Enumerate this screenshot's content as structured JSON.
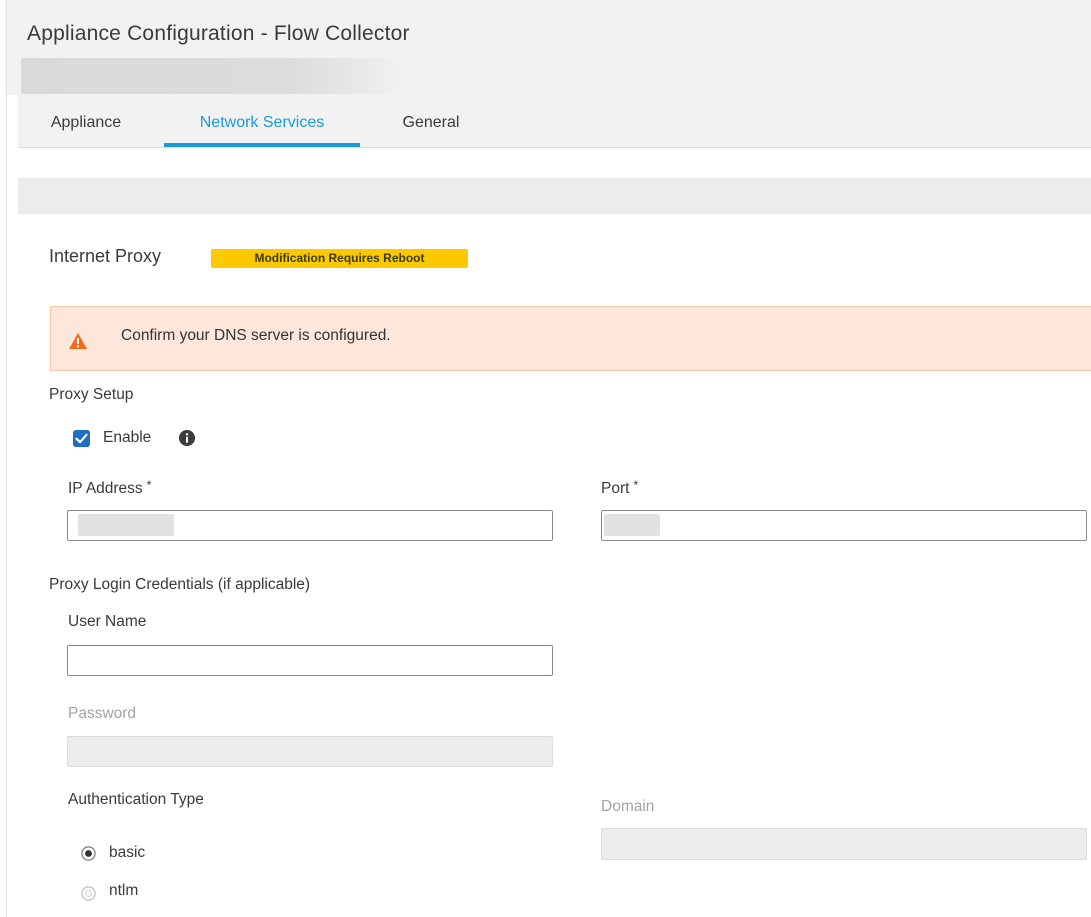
{
  "header": {
    "title": "Appliance Configuration - Flow Collector"
  },
  "tabs": [
    {
      "label": "Appliance",
      "active": false
    },
    {
      "label": "Network Services",
      "active": true
    },
    {
      "label": "General",
      "active": false
    }
  ],
  "section": {
    "title": "Internet Proxy",
    "badge": "Modification Requires Reboot"
  },
  "alert": {
    "text": "Confirm your DNS server is configured.",
    "icon": "warning-triangle-icon"
  },
  "proxy_setup": {
    "label": "Proxy Setup",
    "enable_label": "Enable",
    "enable_checked": true,
    "ip_label": "IP Address",
    "port_label": "Port",
    "required_mark": "*"
  },
  "credentials": {
    "label": "Proxy Login Credentials (if applicable)",
    "username_label": "User Name",
    "username_value": "",
    "password_label": "Password",
    "auth_type_label": "Authentication Type",
    "domain_label": "Domain",
    "auth_options": [
      {
        "label": "basic",
        "selected": true
      },
      {
        "label": "ntlm",
        "selected": false
      }
    ]
  },
  "colors": {
    "accent": "#1a9bd7",
    "badge": "#fcc900",
    "alert_bg": "#fde6da",
    "warning_icon": "#f26a1b",
    "checkbox": "#1e6fc2"
  }
}
